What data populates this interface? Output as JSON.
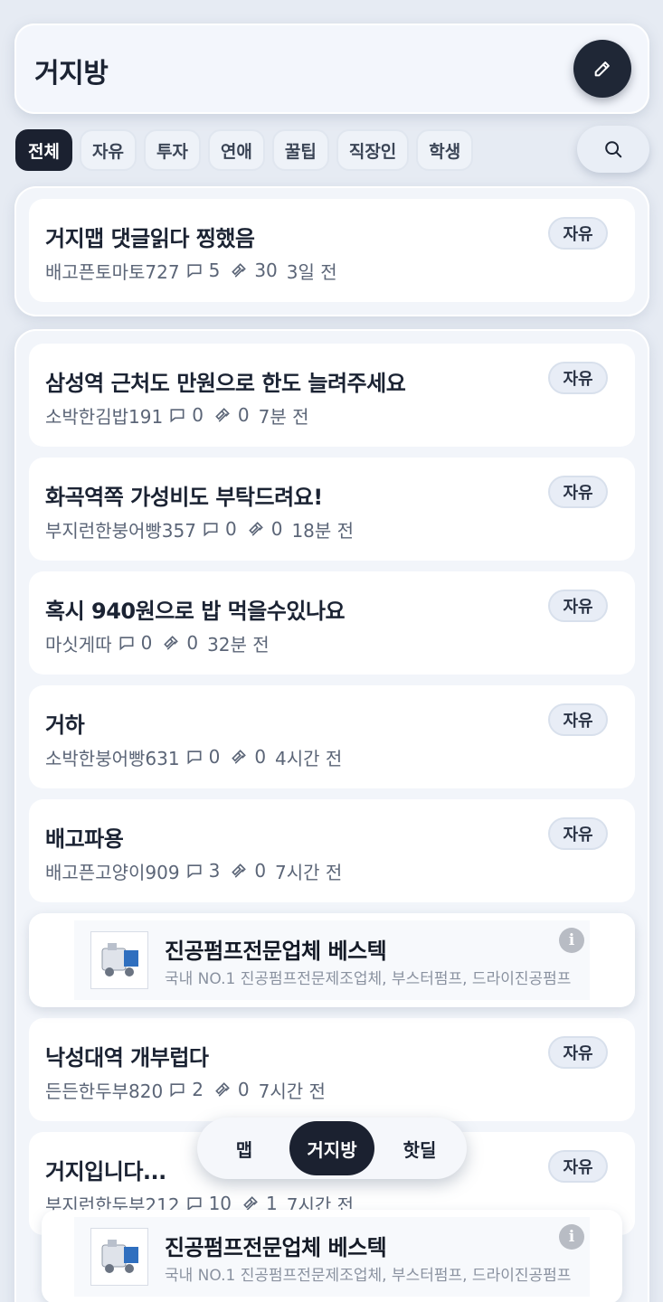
{
  "header": {
    "title": "거지방",
    "write_icon": "pencil-icon"
  },
  "tabs": [
    {
      "label": "전체",
      "active": true
    },
    {
      "label": "자유"
    },
    {
      "label": "투자"
    },
    {
      "label": "연애"
    },
    {
      "label": "꿀팁"
    },
    {
      "label": "직장인"
    },
    {
      "label": "학생"
    }
  ],
  "search": {
    "icon": "search-icon"
  },
  "pinned": {
    "title": "거지맵 댓글읽다 찡했음",
    "author": "배고픈토마토727",
    "comments": "5",
    "likes": "30",
    "time": "3일 전",
    "category": "자유"
  },
  "posts": [
    {
      "title": "삼성역 근처도 만원으로 한도 늘려주세요",
      "author": "소박한김밥191",
      "comments": "0",
      "likes": "0",
      "time": "7분 전",
      "category": "자유"
    },
    {
      "title": "화곡역쪽 가성비도 부탁드려요!",
      "author": "부지런한붕어빵357",
      "comments": "0",
      "likes": "0",
      "time": "18분 전",
      "category": "자유"
    },
    {
      "title": "혹시 940원으로 밥 먹을수있나요",
      "author": "마싯게따",
      "comments": "0",
      "likes": "0",
      "time": "32분 전",
      "category": "자유"
    },
    {
      "title": "거하",
      "author": "소박한붕어빵631",
      "comments": "0",
      "likes": "0",
      "time": "4시간 전",
      "category": "자유"
    },
    {
      "title": "배고파용",
      "author": "배고픈고양이909",
      "comments": "3",
      "likes": "0",
      "time": "7시간 전",
      "category": "자유"
    },
    {
      "title": "낙성대역 개부럽다",
      "author": "든든한두부820",
      "comments": "2",
      "likes": "0",
      "time": "7시간 전",
      "category": "자유"
    },
    {
      "title": "거지입니다...",
      "author": "부지런한두부212",
      "comments": "10",
      "likes": "1",
      "time": "7시간 전",
      "category": "자유"
    }
  ],
  "ad": {
    "title": "진공펌프전문업체 베스텍",
    "description": "국내 NO.1 진공펌프전문제조업체, 부스터펌프, 드라이진공펌프",
    "info_icon": "i"
  },
  "bottom_nav": [
    {
      "label": "맵"
    },
    {
      "label": "거지방",
      "active": true
    },
    {
      "label": "핫딜"
    }
  ]
}
